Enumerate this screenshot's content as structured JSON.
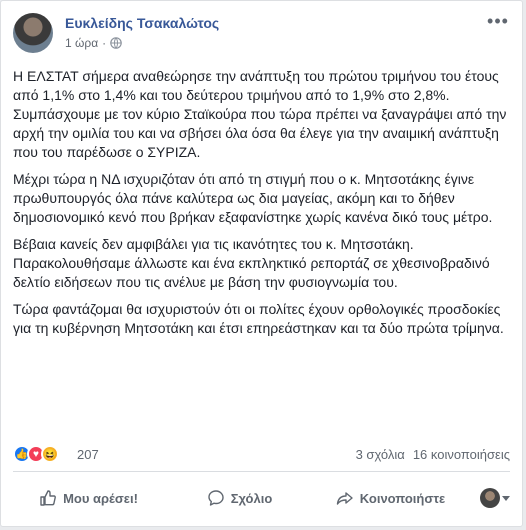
{
  "post": {
    "author": "Ευκλείδης Τσακαλώτος",
    "time": "1 ώρα",
    "more_icon": "more-dots-icon",
    "privacy_icon": "globe-icon",
    "paragraphs": [
      "Η ΕΛΣΤΑΤ σήμερα αναθεώρησε την ανάπτυξη του πρώτου τριμήνου του έτους από 1,1% στο 1,4% και του δεύτερου τριμήνου από το 1,9% στο 2,8%. Συμπάσχουμε με τον κύριο Σταϊκούρα που τώρα πρέπει να ξαναγράψει από την αρχή την ομιλία του και να σβήσει όλα όσα θα έλεγε για την αναιμική ανάπτυξη που του παρέδωσε ο ΣΥΡΙΖΑ.",
      "Μέχρι τώρα η ΝΔ ισχυριζόταν ότι από τη στιγμή που ο κ. Μητσοτάκης έγινε πρωθυπουργός όλα πάνε καλύτερα ως δια μαγείας, ακόμη και το δήθεν δημοσιονομικό κενό που βρήκαν εξαφανίστηκε χωρίς κανένα δικό τους μέτρο.",
      "Βέβαια κανείς δεν αμφιβάλει για τις ικανότητες του κ. Μητσοτάκη. Παρακολουθήσαμε άλλωστε και ένα εκπληκτικό ρεπορτάζ σε χθεσινοβραδινό δελτίο ειδήσεων που τις ανέλυε με βάση την φυσιογνωμία του.",
      "Τώρα φαντάζομαι θα ισχυριστούν ότι οι πολίτες έχουν ορθολογικές προσδοκίες για τη κυβέρνηση Μητσοτάκη και έτσι επηρεάστηκαν και τα δύο πρώτα τρίμηνα."
    ]
  },
  "stats": {
    "reaction_count": "207",
    "comments": "3 σχόλια",
    "shares": "16 κοινοποιήσεις",
    "reaction_icons": [
      "like-icon",
      "love-icon",
      "haha-icon"
    ]
  },
  "actions": {
    "like": "Μου αρέσει!",
    "comment": "Σχόλιο",
    "share": "Κοινοποιήστε"
  },
  "colors": {
    "author": "#385898",
    "like": "#1877f2",
    "love": "#f33e58",
    "haha": "#f7b125"
  }
}
